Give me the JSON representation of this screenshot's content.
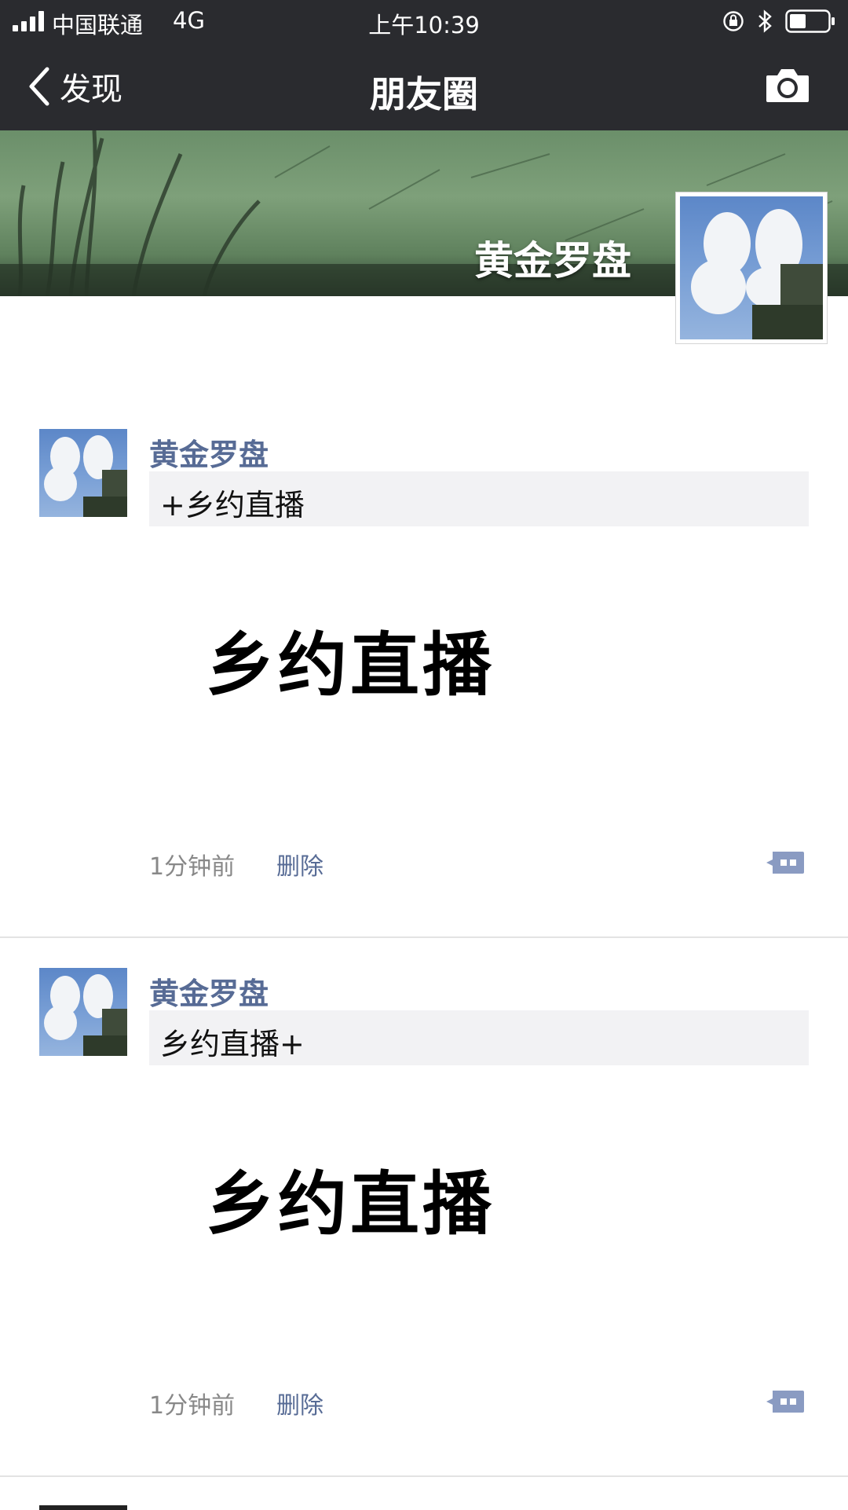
{
  "status_bar": {
    "carrier": "中国联通",
    "network": "4G",
    "time": "上午10:39",
    "icons": [
      "signal-icon",
      "rotation-lock-icon",
      "bluetooth-icon",
      "battery-icon"
    ]
  },
  "nav": {
    "back_label": "发现",
    "title": "朋友圈",
    "camera_icon": "camera-icon"
  },
  "cover": {
    "name": "黄金罗盘"
  },
  "posts": [
    {
      "username": "黄金罗盘",
      "text": "+乡约直播",
      "image_text": "乡约直播",
      "time": "1分钟前",
      "delete_label": "删除"
    },
    {
      "username": "黄金罗盘",
      "text": "乡约直播+",
      "image_text": "乡约直播",
      "time": "1分钟前",
      "delete_label": "删除"
    }
  ],
  "colors": {
    "nav_background": "#2a2b2f",
    "link_blue": "#576b95",
    "text_box_background": "#f2f2f4"
  }
}
